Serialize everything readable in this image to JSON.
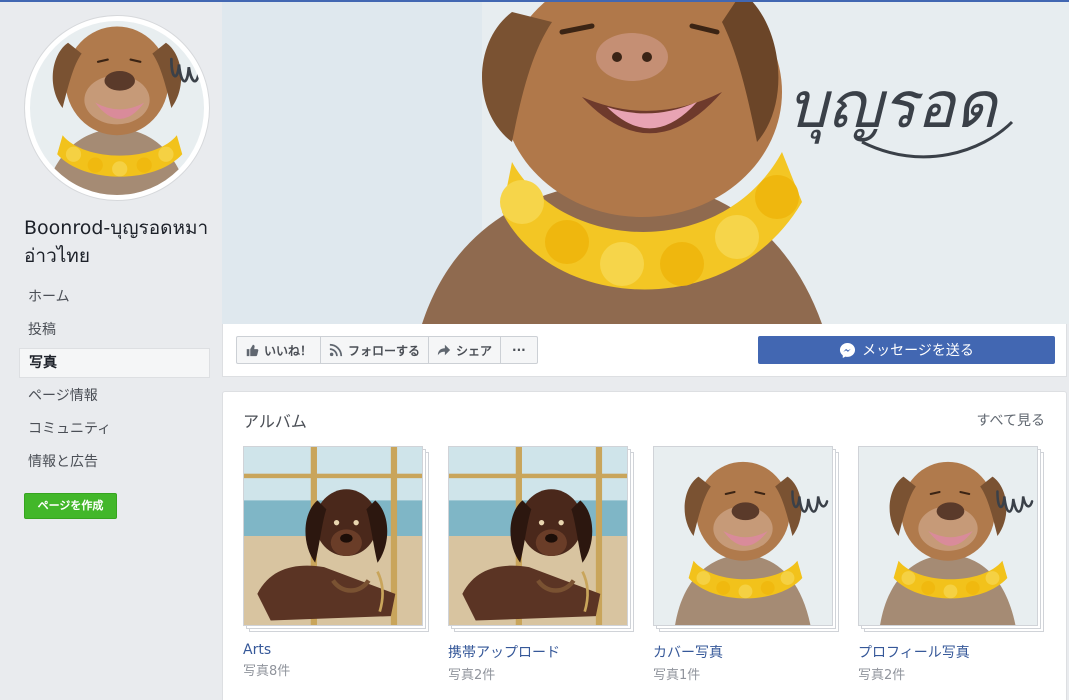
{
  "page": {
    "name": "Boonrod-บุญรอดหมาอ่าวไทย",
    "signature": "บุญรอด"
  },
  "sidebar": {
    "items": [
      {
        "label": "ホーム",
        "active": false
      },
      {
        "label": "投稿",
        "active": false
      },
      {
        "label": "写真",
        "active": true
      },
      {
        "label": "ページ情報",
        "active": false
      },
      {
        "label": "コミュニティ",
        "active": false
      },
      {
        "label": "情報と広告",
        "active": false
      }
    ],
    "create_page_label": "ページを作成"
  },
  "actions": {
    "like_label": "いいね！",
    "follow_label": "フォローする",
    "share_label": "シェア",
    "more_label": "···",
    "message_label": "メッセージを送る"
  },
  "albums": {
    "title": "アルバム",
    "see_all": "すべて見る",
    "items": [
      {
        "name": "Arts",
        "count": "写真8件",
        "art": "brown-dog-on-boat"
      },
      {
        "name": "携帯アップロード",
        "count": "写真2件",
        "art": "brown-dog-on-boat"
      },
      {
        "name": "カバー写真",
        "count": "写真1件",
        "art": "smiling-dog-with-garland"
      },
      {
        "name": "プロフィール写真",
        "count": "写真2件",
        "art": "smiling-dog-with-garland"
      }
    ]
  },
  "colors": {
    "brand": "#4267b2",
    "create_green": "#42b72a",
    "link": "#365899",
    "background": "#e9ebee"
  }
}
